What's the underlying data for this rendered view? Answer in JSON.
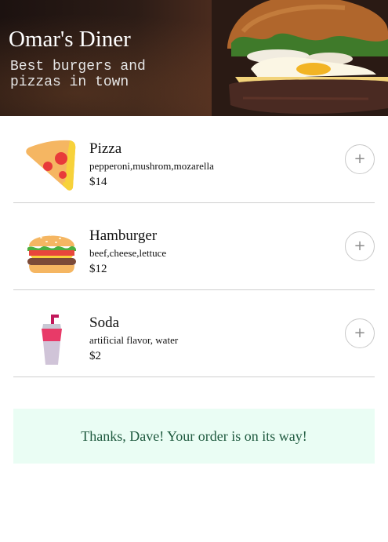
{
  "hero": {
    "title": "Omar's Diner",
    "tagline": "Best burgers and pizzas in town"
  },
  "menu": {
    "items": [
      {
        "name": "Pizza",
        "description": "pepperoni,mushrom,mozarella",
        "price": "$14",
        "icon": "pizza-icon"
      },
      {
        "name": "Hamburger",
        "description": "beef,cheese,lettuce",
        "price": "$12",
        "icon": "hamburger-icon"
      },
      {
        "name": "Soda",
        "description": "artificial flavor, water",
        "price": "$2",
        "icon": "soda-icon"
      }
    ],
    "add_button_label": "+"
  },
  "confirmation": {
    "message": "Thanks, Dave! Your order is on its way!"
  },
  "colors": {
    "confirmation_background": "#eafdf4",
    "confirmation_text": "#1f5a3f"
  }
}
